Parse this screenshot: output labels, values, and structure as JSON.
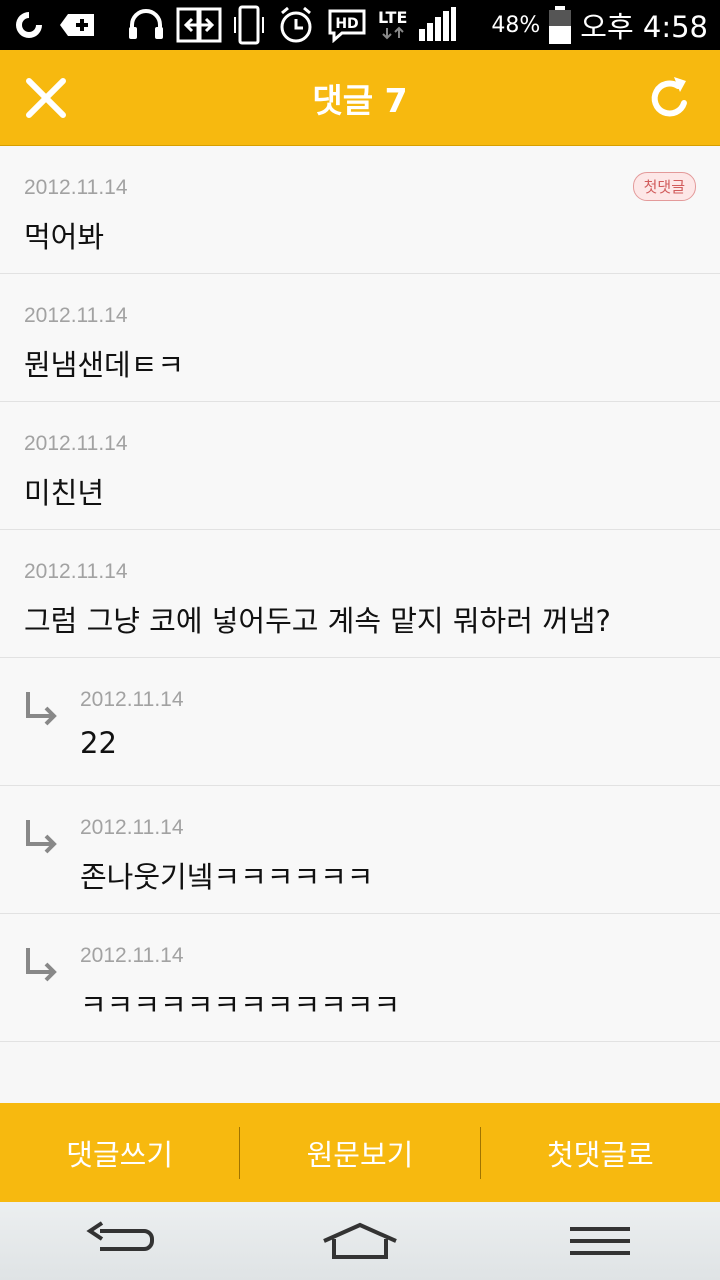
{
  "status_bar": {
    "battery": "48%",
    "network": "LTE",
    "hd": "HD",
    "time": "오후 4:58"
  },
  "header": {
    "title": "댓글 7",
    "close_icon": "close-icon",
    "refresh_icon": "refresh-icon"
  },
  "comments": [
    {
      "date": "2012.11.14",
      "text": "먹어봐",
      "badge": "첫댓글",
      "reply": false
    },
    {
      "date": "2012.11.14",
      "text": "뭔냄샌데ㅌㅋ",
      "reply": false
    },
    {
      "date": "2012.11.14",
      "text": "미친년",
      "reply": false
    },
    {
      "date": "2012.11.14",
      "text": "그럼 그냥 코에 넣어두고 계속 맡지 뭐하러 꺼냄?",
      "reply": false
    },
    {
      "date": "2012.11.14",
      "text": "22",
      "reply": true
    },
    {
      "date": "2012.11.14",
      "text": "존나웃기넼ㅋㅋㅋㅋㅋㅋ",
      "reply": true
    },
    {
      "date": "2012.11.14",
      "text": "ㅋㅋㅋㅋㅋㅋㅋㅋㅋㅋㅋㅋ",
      "reply": true
    }
  ],
  "actions": {
    "write": "댓글쓰기",
    "original": "원문보기",
    "first": "첫댓글로"
  },
  "colors": {
    "accent": "#f7b90f",
    "badge": "#d15c5c"
  }
}
